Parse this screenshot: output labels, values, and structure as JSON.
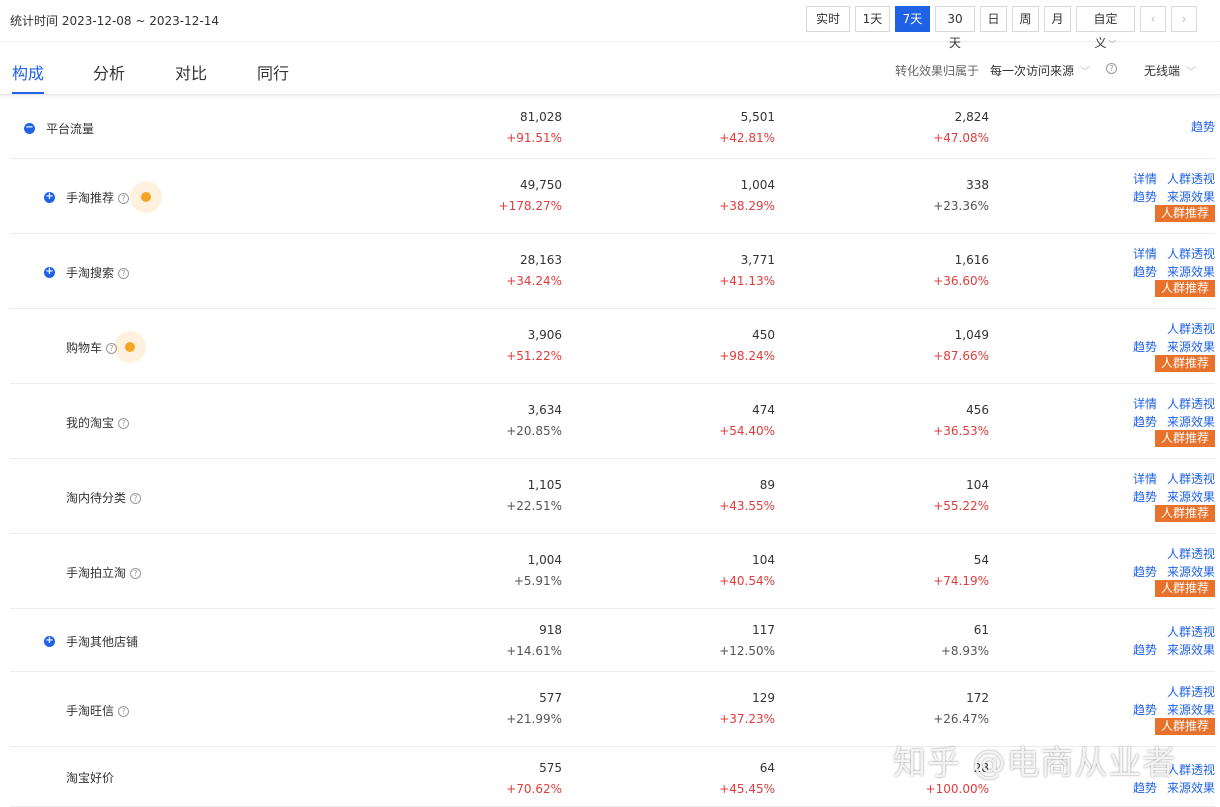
{
  "header": {
    "stat_time": "统计时间 2023-12-08 ~ 2023-12-14",
    "ranges": [
      "实时",
      "1天",
      "7天",
      "30天",
      "日",
      "周",
      "月",
      "自定义"
    ],
    "active_range": "7天",
    "prev_icon": "chevron-left-icon",
    "next_icon": "chevron-right-icon"
  },
  "tabs": {
    "items": [
      "构成",
      "分析",
      "对比",
      "同行"
    ],
    "active": "构成",
    "attribution_label": "转化效果归属于",
    "attribution_value": "每一次访问来源",
    "device_value": "无线端"
  },
  "ops_labels": {
    "detail": "详情",
    "crowd_view": "人群透视",
    "trend": "趋势",
    "source_effect": "来源效果",
    "crowd_recommend": "人群推荐"
  },
  "rows": [
    {
      "name": "平台流量",
      "v1": "81,028",
      "p1": "+91.51%",
      "v2": "5,501",
      "p2": "+42.81%",
      "v3": "2,824",
      "p3": "+47.08%"
    },
    {
      "name": "手淘推荐",
      "v1": "49,750",
      "p1": "+178.27%",
      "v2": "1,004",
      "p2": "+38.29%",
      "v3": "338",
      "p3": "+23.36%"
    },
    {
      "name": "手淘搜索",
      "v1": "28,163",
      "p1": "+34.24%",
      "v2": "3,771",
      "p2": "+41.13%",
      "v3": "1,616",
      "p3": "+36.60%"
    },
    {
      "name": "购物车",
      "v1": "3,906",
      "p1": "+51.22%",
      "v2": "450",
      "p2": "+98.24%",
      "v3": "1,049",
      "p3": "+87.66%"
    },
    {
      "name": "我的淘宝",
      "v1": "3,634",
      "p1": "+20.85%",
      "v2": "474",
      "p2": "+54.40%",
      "v3": "456",
      "p3": "+36.53%"
    },
    {
      "name": "淘内待分类",
      "v1": "1,105",
      "p1": "+22.51%",
      "v2": "89",
      "p2": "+43.55%",
      "v3": "104",
      "p3": "+55.22%"
    },
    {
      "name": "手淘拍立淘",
      "v1": "1,004",
      "p1": "+5.91%",
      "v2": "104",
      "p2": "+40.54%",
      "v3": "54",
      "p3": "+74.19%"
    },
    {
      "name": "手淘其他店铺",
      "v1": "918",
      "p1": "+14.61%",
      "v2": "117",
      "p2": "+12.50%",
      "v3": "61",
      "p3": "+8.93%"
    },
    {
      "name": "手淘旺信",
      "v1": "577",
      "p1": "+21.99%",
      "v2": "129",
      "p2": "+37.23%",
      "v3": "172",
      "p3": "+26.47%"
    },
    {
      "name": "淘宝好价",
      "v1": "575",
      "p1": "+70.62%",
      "v2": "64",
      "p2": "+45.45%",
      "v3": "28",
      "p3": "+100.00%"
    }
  ],
  "watermark": "知乎 @电商从业者"
}
